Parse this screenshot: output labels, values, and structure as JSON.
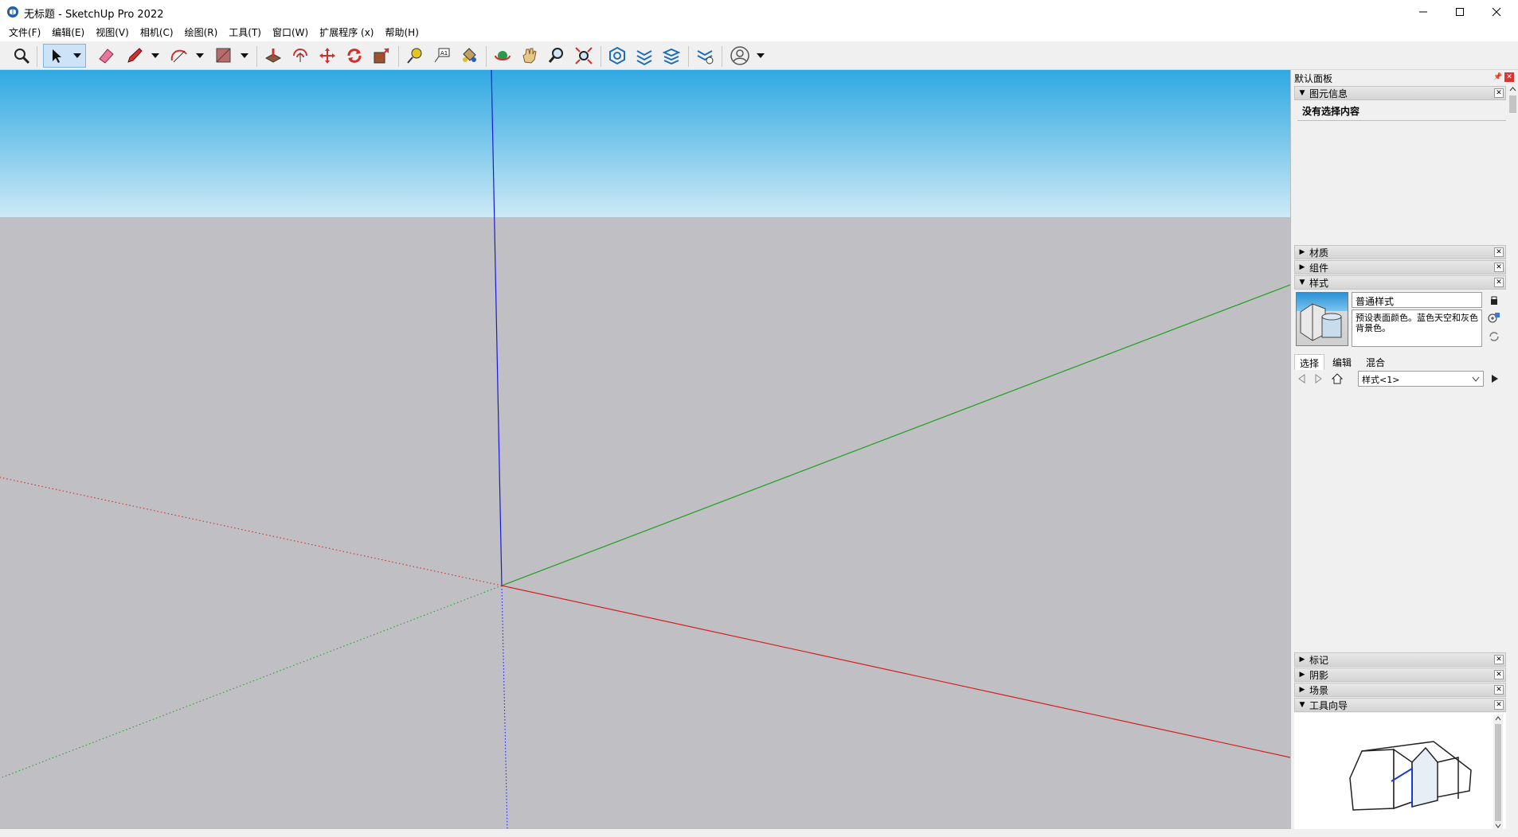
{
  "window": {
    "title": "无标题 - SketchUp Pro 2022"
  },
  "menu": [
    "文件(F)",
    "编辑(E)",
    "视图(V)",
    "相机(C)",
    "绘图(R)",
    "工具(T)",
    "窗口(W)",
    "扩展程序 (x)",
    "帮助(H)"
  ],
  "toolbar": {
    "icons": [
      "search-tool-icon",
      "select-arrow-icon",
      "eraser-icon",
      "pencil-icon",
      "arc-icon",
      "shape-icon",
      "push-pull-icon",
      "offset-icon",
      "move-icon",
      "rotate-icon",
      "scale-icon",
      "tape-measure-icon",
      "text-label-icon",
      "paint-bucket-icon",
      "orbit-icon",
      "pan-icon",
      "zoom-icon",
      "zoom-extents-icon",
      "3d-warehouse-icon",
      "extension-warehouse-icon",
      "layout-icon",
      "extension-manager-icon",
      "account-icon"
    ]
  },
  "colors": {
    "sky_top": "#2fa8e2",
    "sky_bottom": "#cde9f5",
    "ground": "#bfbfc4",
    "axis_red": "#d42020",
    "axis_green": "#1aa01a",
    "axis_blue": "#1a1ad6"
  },
  "tray": {
    "title": "默认面板",
    "panels": {
      "entity_info": {
        "name": "图元信息",
        "empty": "没有选择内容"
      },
      "materials": {
        "name": "材质"
      },
      "components": {
        "name": "组件"
      },
      "styles": {
        "name": "样式",
        "style_name": "普通样式",
        "description": "预设表面颜色。蓝色天空和灰色背景色。",
        "tabs": [
          "选择",
          "编辑",
          "混合"
        ],
        "dropdown": "样式<1>"
      },
      "tags": {
        "name": "标记"
      },
      "shadows": {
        "name": "阴影"
      },
      "scenes": {
        "name": "场景"
      },
      "instructor": {
        "name": "工具向导"
      }
    }
  }
}
